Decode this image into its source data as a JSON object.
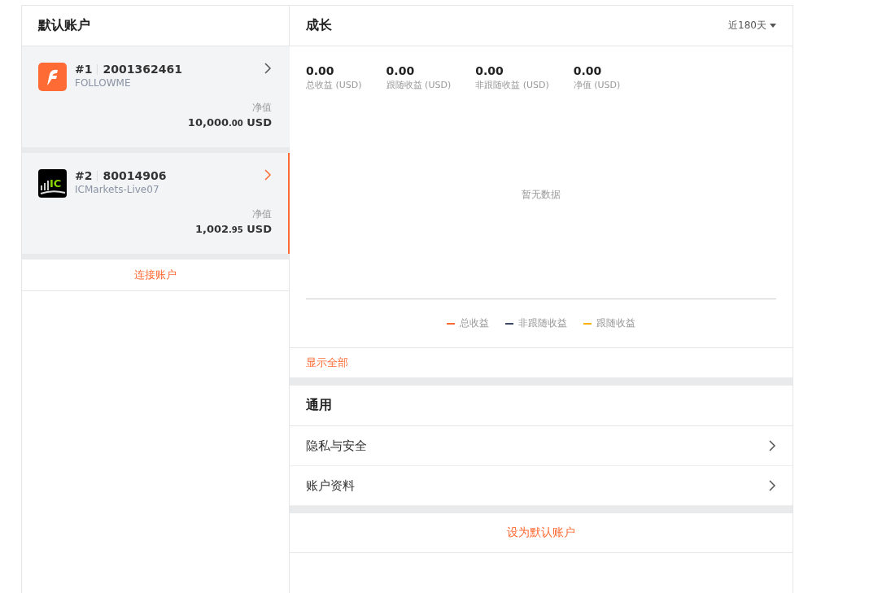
{
  "accounts_panel": {
    "title": "默认账户",
    "accounts": [
      {
        "kind": "followme",
        "index": "#1",
        "number": "2001362461",
        "server": "FOLLOWME",
        "value_label": "净值",
        "value_int": "10,000",
        "value_dec": ".00",
        "currency": "USD",
        "selected": false
      },
      {
        "kind": "icmarkets",
        "logo_text": "IC",
        "index": "#2",
        "number": "80014906",
        "server": "ICMarkets-Live07",
        "value_label": "净值",
        "value_int": "1,002",
        "value_dec": ".95",
        "currency": "USD",
        "selected": true
      }
    ],
    "connect_link": "连接账户"
  },
  "growth": {
    "title": "成长",
    "period": "近180天",
    "stats": [
      {
        "value": "0.00",
        "label": "总收益 (USD)"
      },
      {
        "value": "0.00",
        "label": "跟随收益 (USD)"
      },
      {
        "value": "0.00",
        "label": "非跟随收益 (USD)"
      },
      {
        "value": "0.00",
        "label": "净值 (USD)"
      }
    ],
    "empty_text": "暂无数据",
    "legend": [
      {
        "label": "总收益",
        "color": "#ff6b35"
      },
      {
        "label": "非跟随收益",
        "color": "#3d4a66"
      },
      {
        "label": "跟随收益",
        "color": "#ffb300"
      }
    ],
    "show_all": "显示全部"
  },
  "general": {
    "title": "通用",
    "items": [
      "隐私与安全",
      "账户资料"
    ]
  },
  "set_default_button": "设为默认账户"
}
